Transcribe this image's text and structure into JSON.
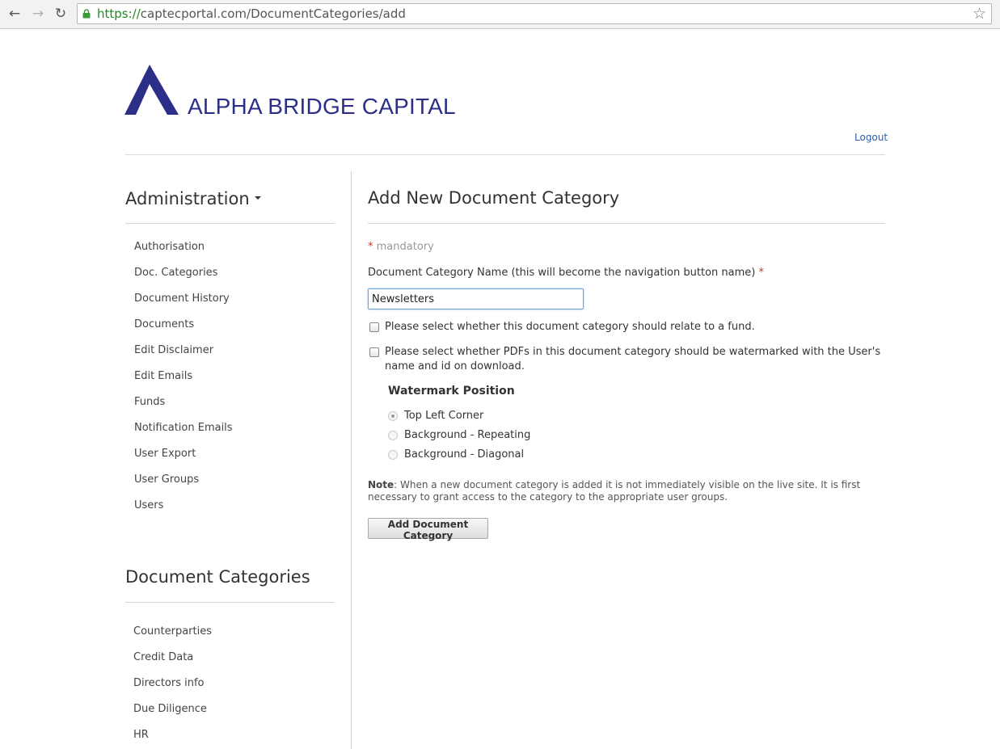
{
  "browser": {
    "url_scheme": "https://",
    "url_rest": "captecportal.com/DocumentCategories/add",
    "back_icon": "back-arrow-icon",
    "forward_icon": "forward-arrow-icon",
    "reload_icon": "reload-icon",
    "lock_icon": "lock-icon",
    "star_icon": "bookmark-star-icon"
  },
  "header": {
    "brand": "ALPHA BRIDGE CAPITAL",
    "logout": "Logout",
    "brand_color": "#2b2f88"
  },
  "sidebar": {
    "admin_heading": "Administration",
    "admin_items": [
      "Authorisation",
      "Doc. Categories",
      "Document History",
      "Documents",
      "Edit Disclaimer",
      "Edit Emails",
      "Funds",
      "Notification Emails",
      "User Export",
      "User Groups",
      "Users"
    ],
    "doc_heading": "Document Categories",
    "doc_items": [
      "Counterparties",
      "Credit Data",
      "Directors info",
      "Due Diligence",
      "HR"
    ]
  },
  "main": {
    "title": "Add New Document Category",
    "mandatory_star": "*",
    "mandatory_text": "mandatory",
    "name_label": "Document Category Name (this will become the navigation button name)",
    "name_required": "*",
    "name_value": "Newsletters",
    "fund_checkbox_label": "Please select whether this document category should relate to a fund.",
    "watermark_checkbox_label": "Please select whether PDFs in this document category should be watermarked with the User's name and id on download.",
    "watermark_heading": "Watermark Position",
    "radio_options": [
      "Top Left Corner",
      "Background - Repeating",
      "Background - Diagonal"
    ],
    "selected_radio": "Top Left Corner",
    "note_label": "Note",
    "note_text": ": When a new document category is added it is not immediately visible on the live site. It is first necessary to grant access to the category to the appropriate user groups.",
    "submit_label": "Add Document Category"
  }
}
